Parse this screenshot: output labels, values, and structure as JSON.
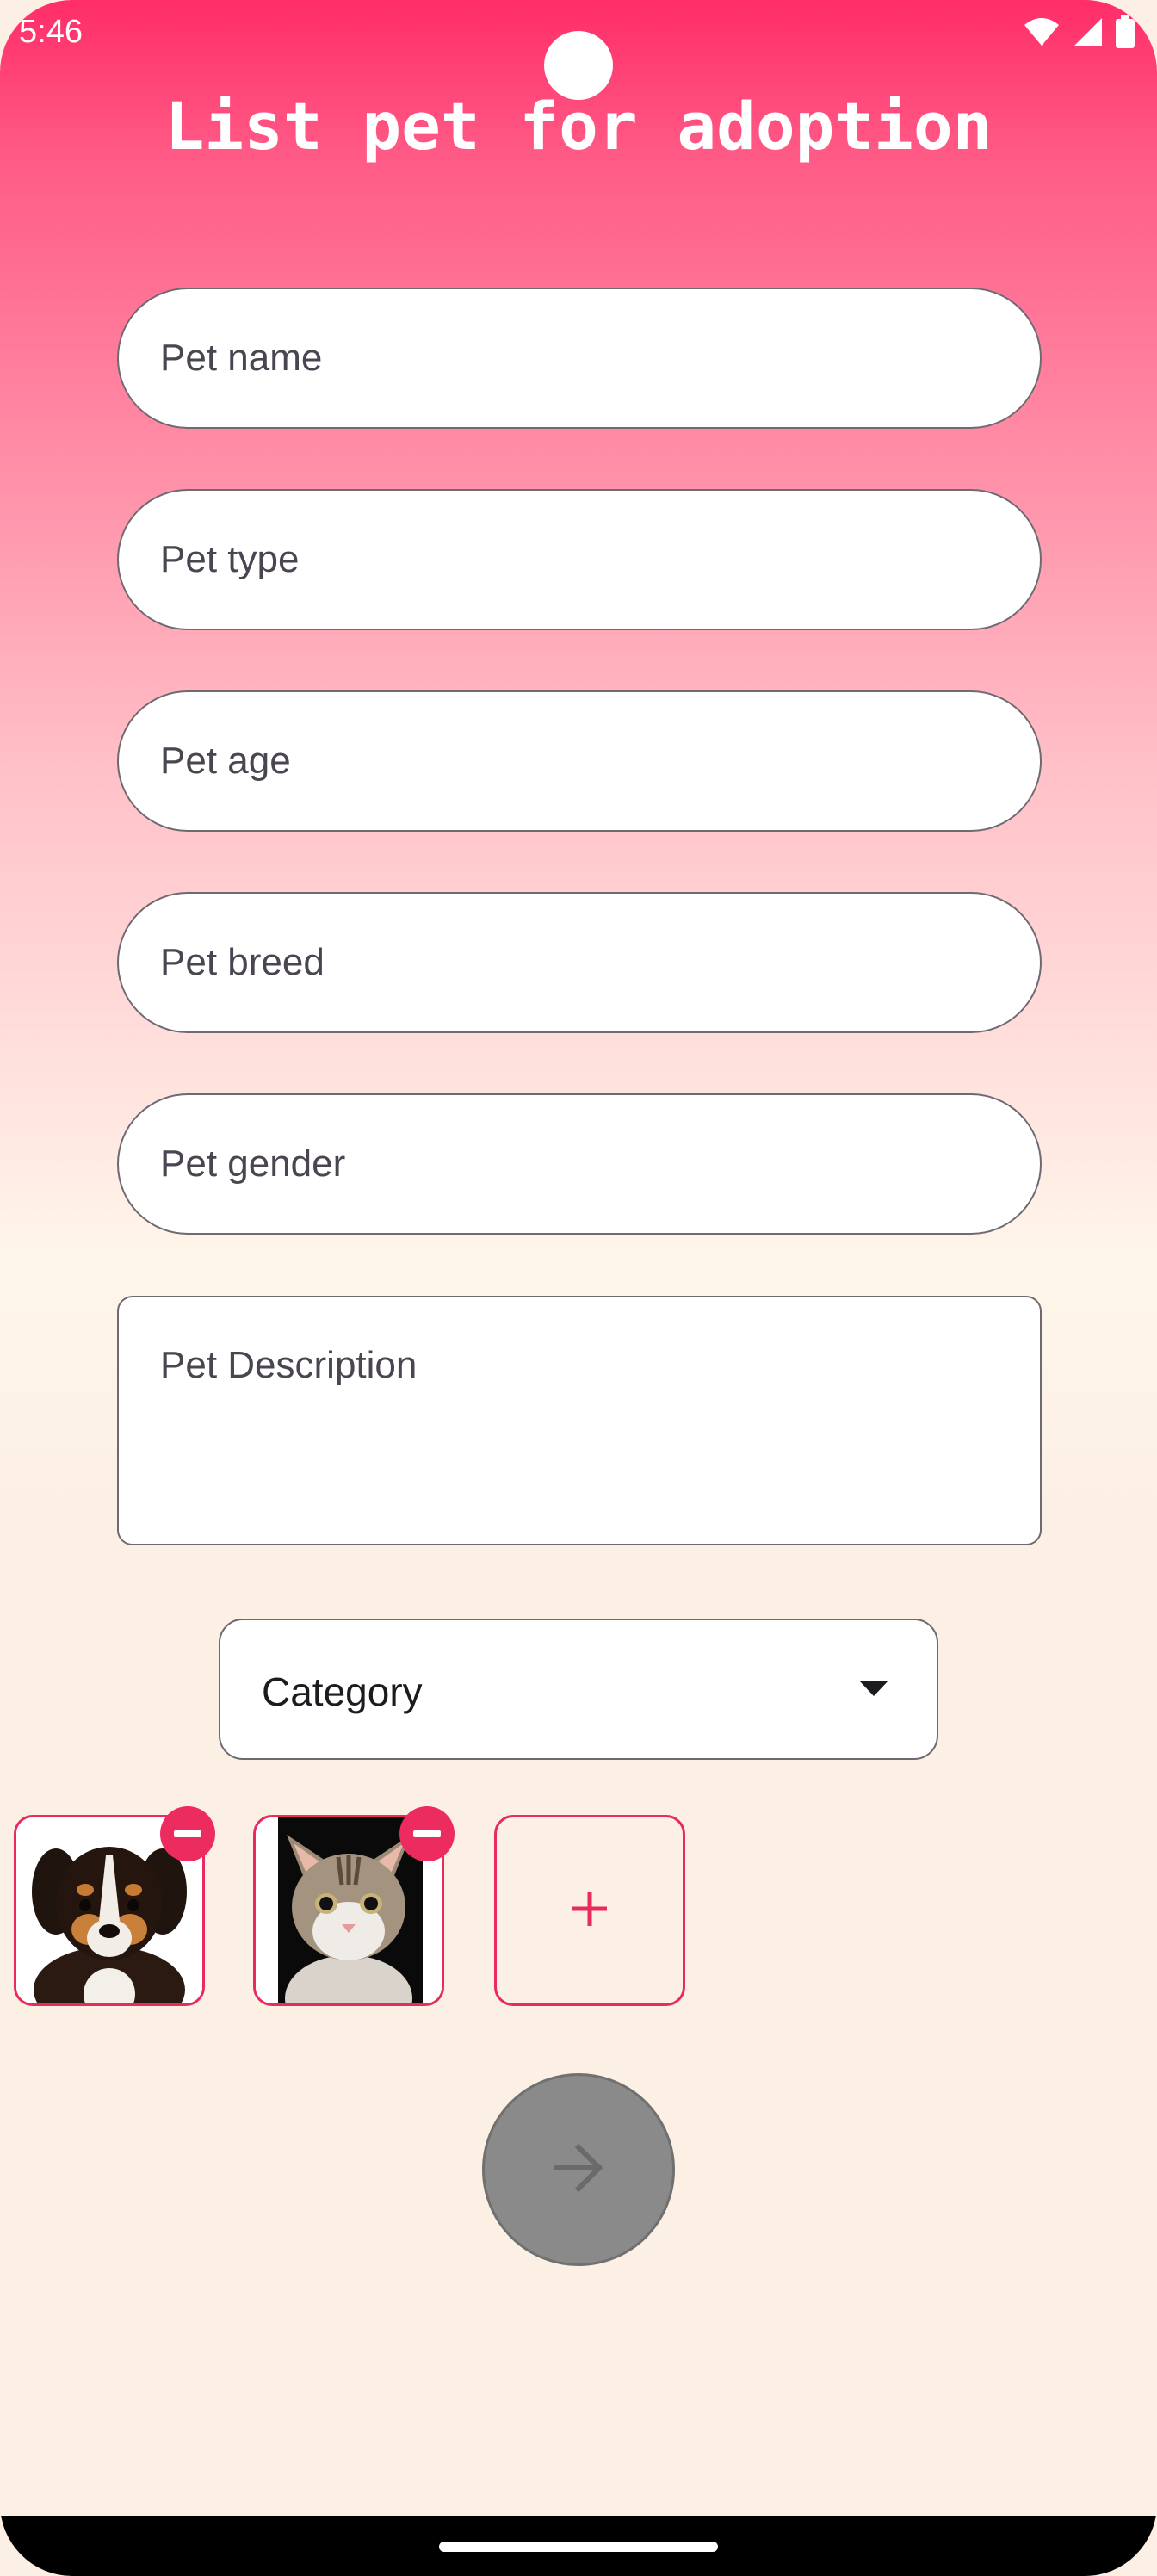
{
  "status_bar": {
    "time": "5:46",
    "icons": [
      "wifi-icon",
      "cellular-signal-icon",
      "battery-icon"
    ]
  },
  "header": {
    "title": "List pet for adoption"
  },
  "form": {
    "pet_name_placeholder": "Pet name",
    "pet_type_placeholder": "Pet type",
    "pet_age_placeholder": "Pet age",
    "pet_breed_placeholder": "Pet breed",
    "pet_gender_placeholder": "Pet gender",
    "pet_description_placeholder": "Pet Description",
    "category_label": "Category"
  },
  "photos": [
    {
      "name": "puppy-photo",
      "icon": "remove-icon"
    },
    {
      "name": "cat-photo",
      "icon": "remove-icon"
    }
  ],
  "add_photo_icon": "plus-icon",
  "next_button_icon": "arrow-right-icon",
  "colors": {
    "accent": "#ec2c5f",
    "gradient_top": "#ff2d68",
    "background": "#fcefe3",
    "fab": "#8a8a8a"
  }
}
